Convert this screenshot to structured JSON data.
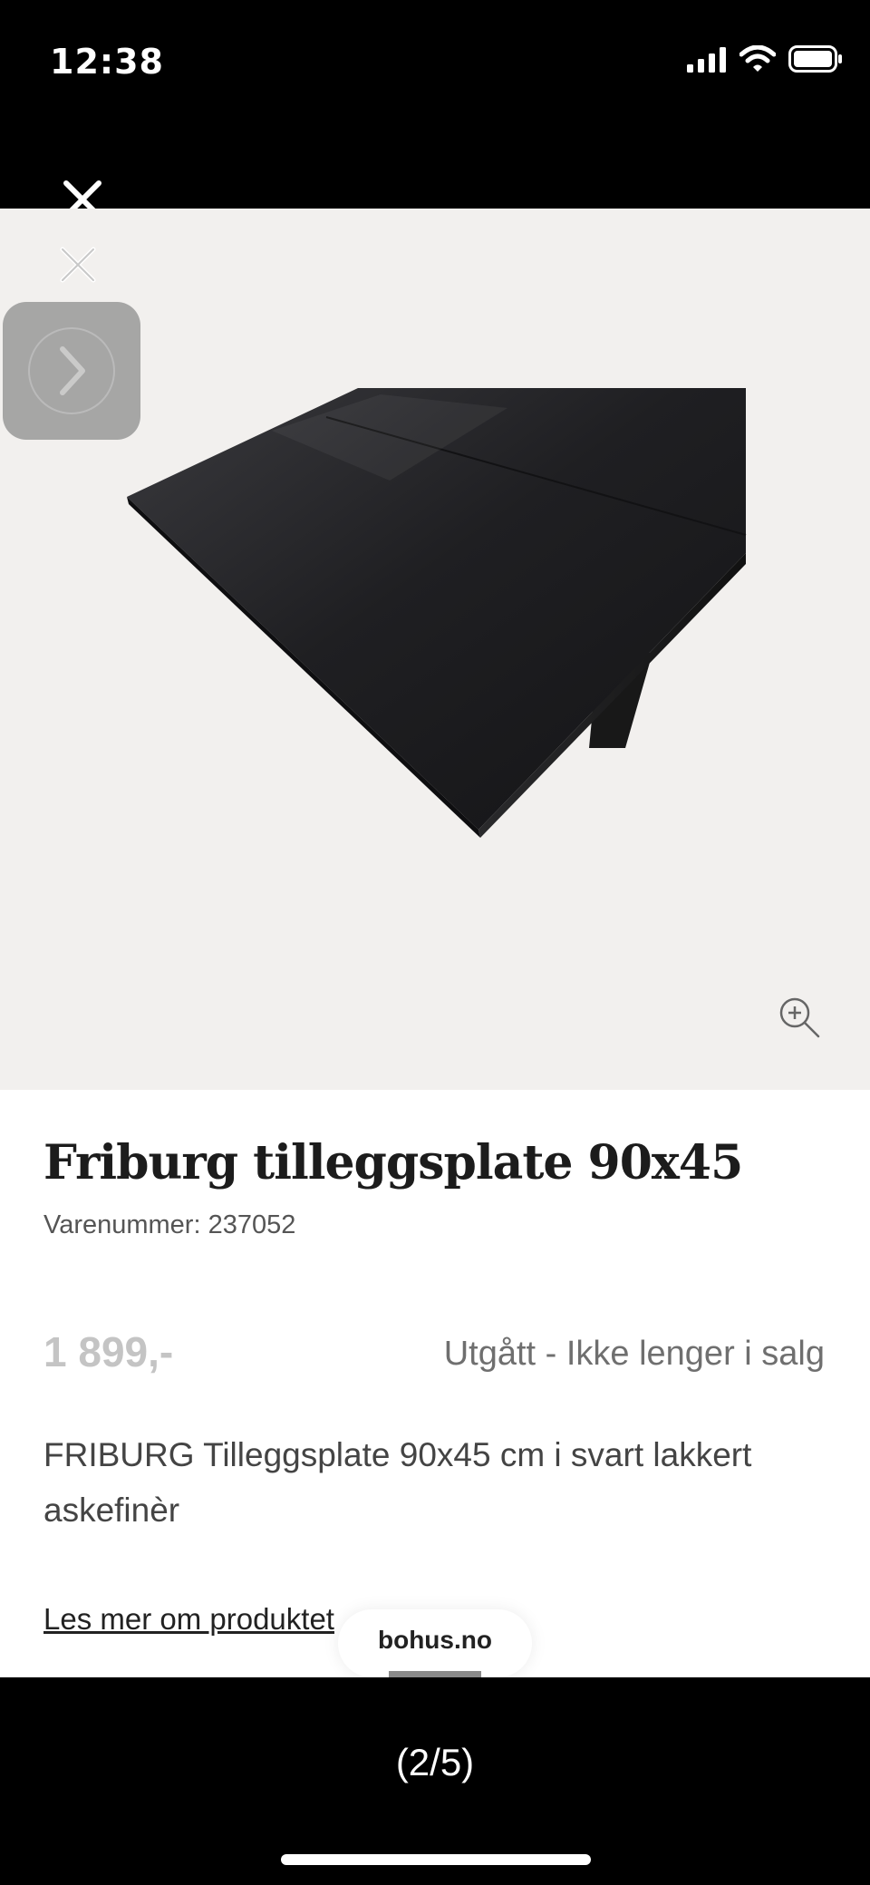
{
  "status_bar": {
    "time": "12:38"
  },
  "viewer": {
    "close_icon": "close-icon",
    "next_icon": "chevron-right-icon",
    "zoom_icon": "zoom-in-icon",
    "page_counter": "(2/5)"
  },
  "product": {
    "title": "Friburg tilleggsplate 90x45",
    "sku": "Varenummer: 237052",
    "price": "1 899,-",
    "availability": "Utgått - Ikke lenger i salg",
    "description": "FRIBURG Tilleggsplate 90x45 cm i svart lakkert askefinèr",
    "read_more": "Les mer om produktet"
  },
  "browser": {
    "domain": "bohus.no"
  },
  "colors": {
    "background": "#000000",
    "image_bg": "#f2f0ee",
    "title": "#1c1c1c",
    "price_muted": "#c4c4c4"
  }
}
